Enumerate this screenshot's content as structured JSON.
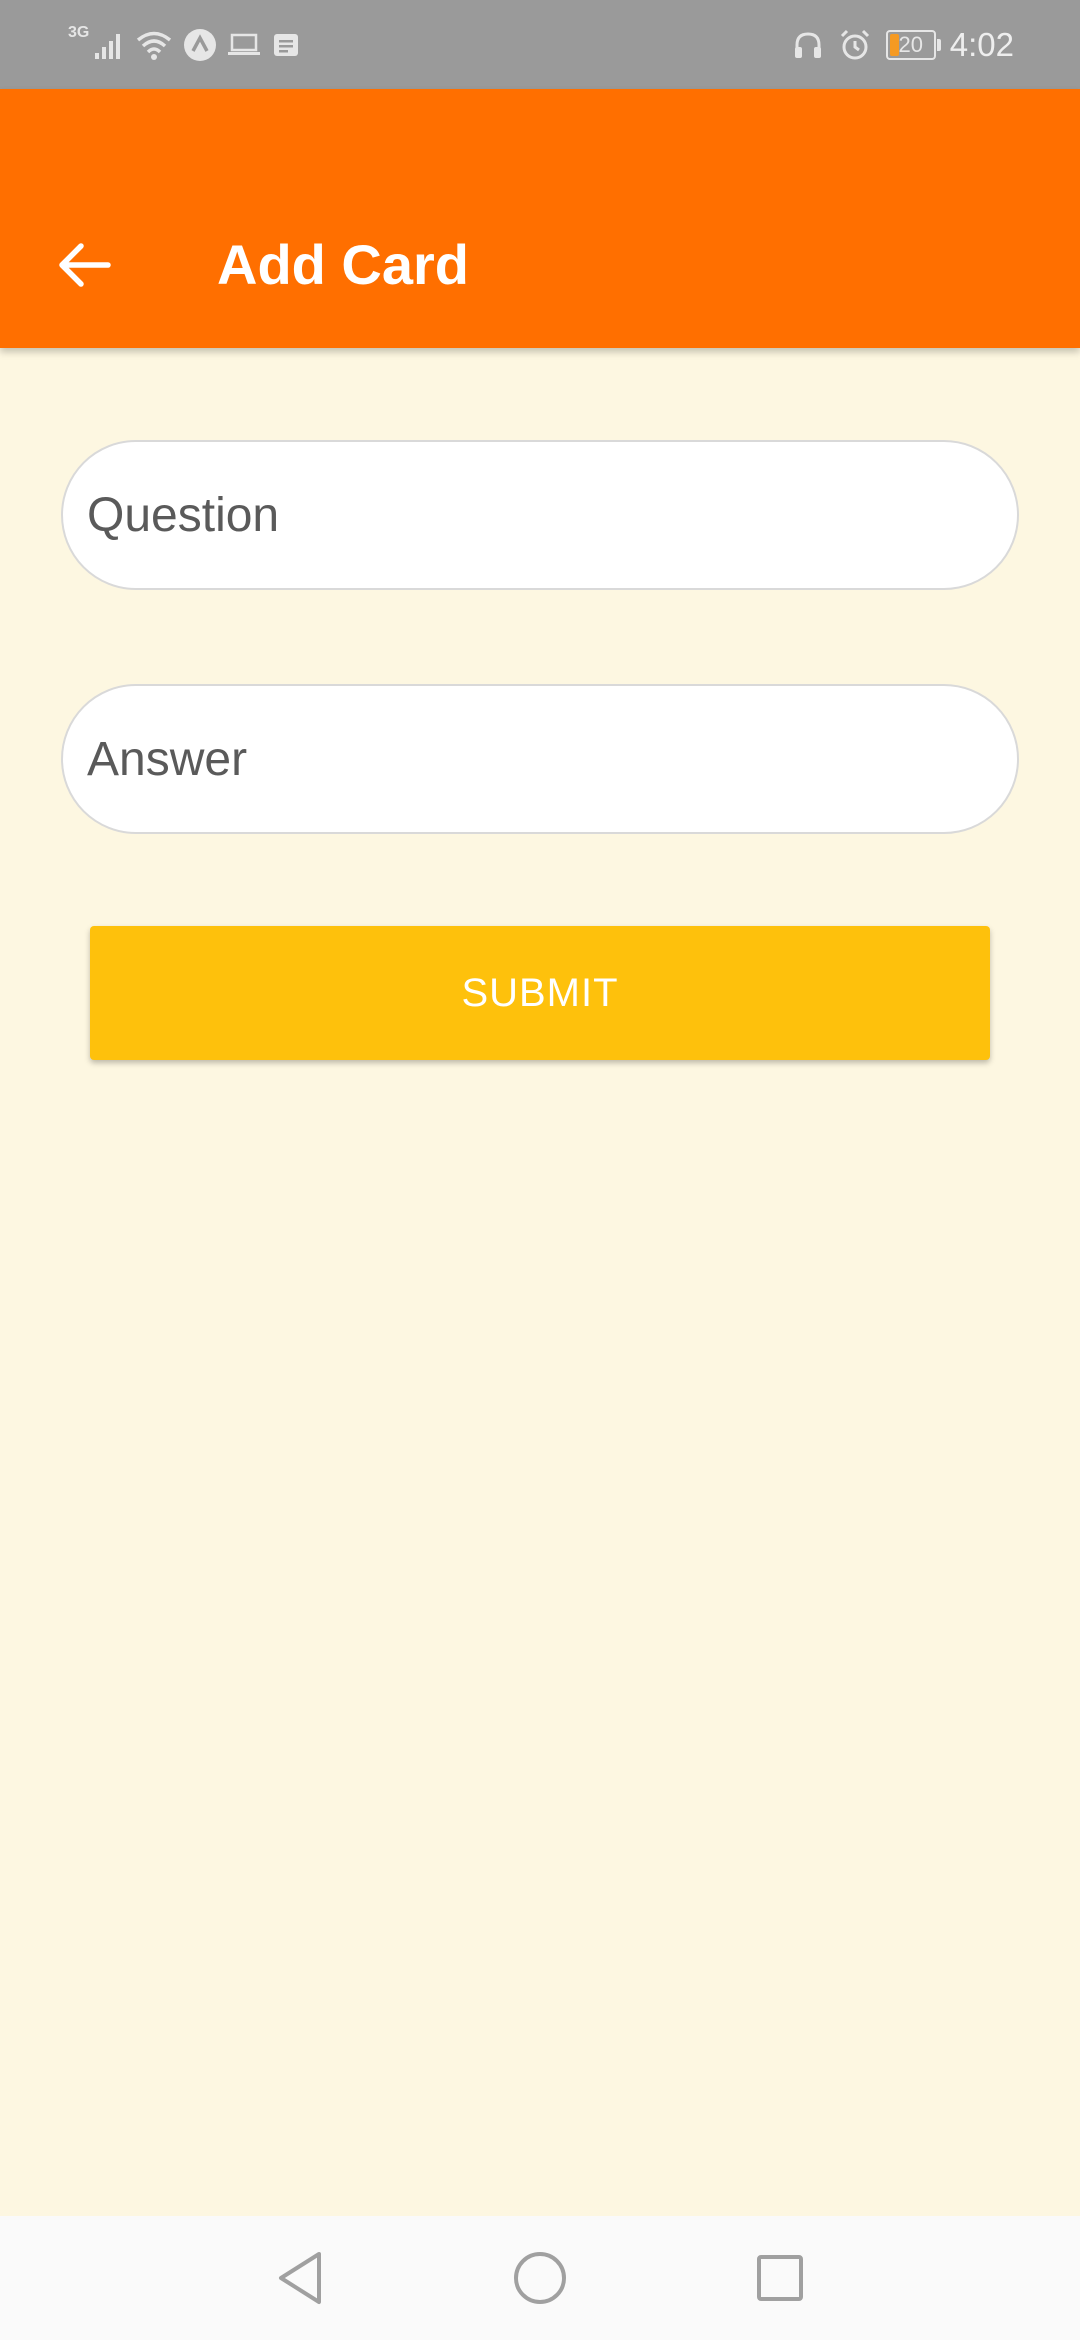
{
  "status_bar": {
    "network_label": "3G",
    "time": "4:02",
    "battery_level": "20",
    "icons_left": [
      "signal-icon",
      "wifi-icon",
      "app-notification-icon",
      "laptop-icon",
      "message-icon"
    ],
    "icons_right": [
      "headphones-icon",
      "alarm-icon",
      "battery-icon"
    ],
    "colors": {
      "background": "#9a9a9a",
      "battery_fill": "#f59a23"
    }
  },
  "app_bar": {
    "title": "Add Card",
    "back_icon": "arrow-back-icon",
    "color": "#ff6f00"
  },
  "form": {
    "question": {
      "value": "",
      "placeholder": "Question"
    },
    "answer": {
      "value": "",
      "placeholder": "Answer"
    },
    "submit_label": "SUBMIT",
    "submit_color": "#fec10c"
  },
  "nav_bar": {
    "buttons": [
      "back-triangle-icon",
      "home-circle-icon",
      "recents-square-icon"
    ]
  },
  "theme": {
    "background": "#fdf7e1"
  }
}
